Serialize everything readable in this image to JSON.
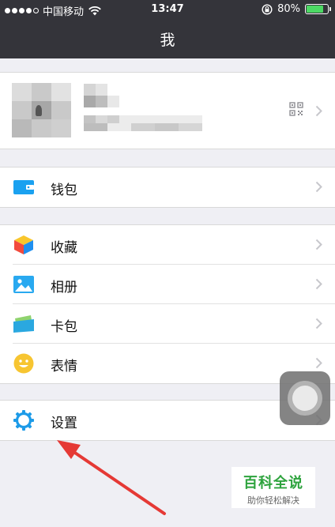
{
  "status_bar": {
    "carrier": "中国移动",
    "time": "13:47",
    "battery_percent": "80%",
    "battery_level": 0.8
  },
  "nav": {
    "title": "我"
  },
  "menu": {
    "wallet": {
      "label": "钱包",
      "icon": "wallet-icon",
      "color": "#1aa1f0"
    },
    "favorites": {
      "label": "收藏",
      "icon": "favorites-cube-icon"
    },
    "album": {
      "label": "相册",
      "icon": "album-icon",
      "color": "#29a9f0"
    },
    "cards": {
      "label": "卡包",
      "icon": "card-package-icon"
    },
    "stickers": {
      "label": "表情",
      "icon": "smiley-icon",
      "color": "#f7c531"
    },
    "settings": {
      "label": "设置",
      "icon": "gear-icon",
      "color": "#1d9be8"
    }
  },
  "watermark": {
    "title": "百科全说",
    "subtitle": "助你轻松解决"
  },
  "colors": {
    "nav_bg": "#34343a",
    "page_bg": "#efeff4",
    "arrow": "#e53935",
    "battery": "#4cd964"
  }
}
